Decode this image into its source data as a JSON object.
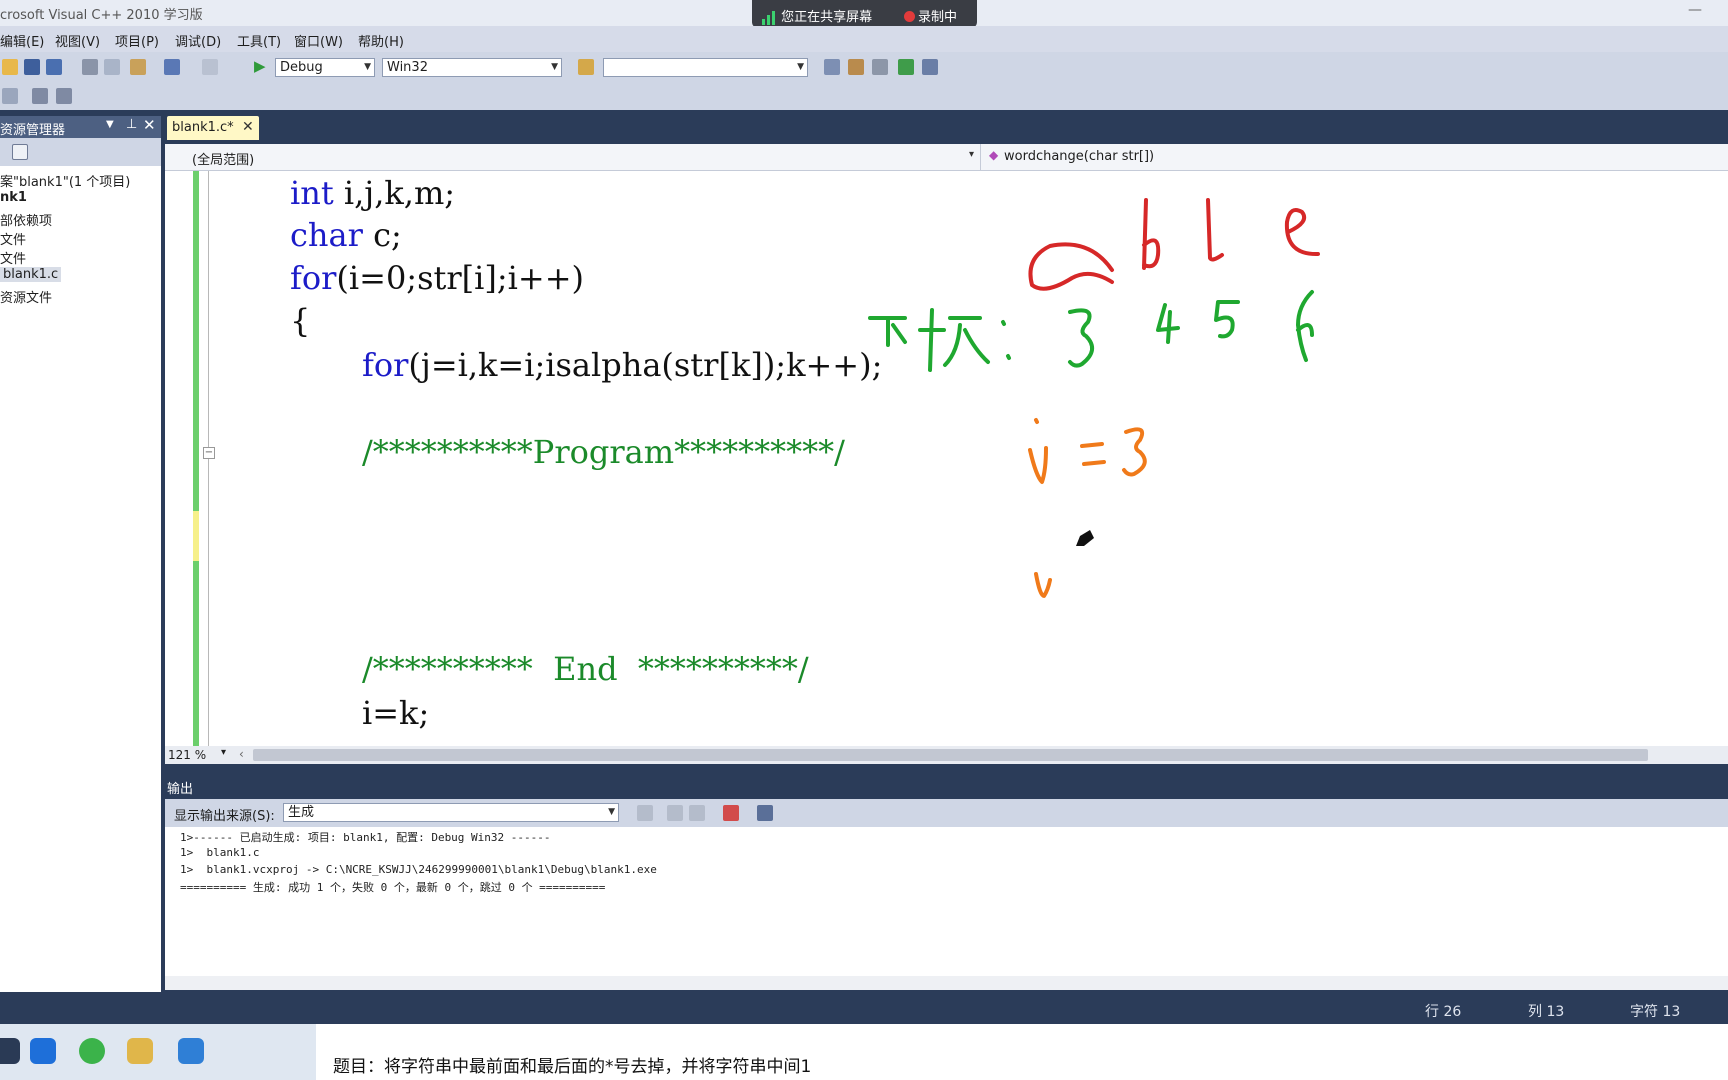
{
  "window": {
    "title": "crosoft Visual C++ 2010 学习版",
    "minimize": "—"
  },
  "share": {
    "sharing_text": "您正在共享屏幕",
    "recording_text": "录制中"
  },
  "menu": [
    "编辑(E)",
    "视图(V)",
    "项目(P)",
    "调试(D)",
    "工具(T)",
    "窗口(W)",
    "帮助(H)"
  ],
  "toolbar": {
    "config": "Debug",
    "platform": "Win32",
    "find": ""
  },
  "solution_explorer": {
    "title": "资源管理器",
    "items": [
      "案\"blank1\"(1 个项目)",
      "nk1",
      "部依赖项",
      "文件",
      "文件",
      "blank1.c",
      "资源文件"
    ]
  },
  "editor": {
    "tab_label": "blank1.c*",
    "scope": "(全局范围)",
    "function": "wordchange(char str[])",
    "zoom": "121 %",
    "lines": [
      {
        "kw": "int",
        "rest": " i,j,k,m;"
      },
      {
        "kw": "char",
        "rest": " c;"
      },
      {
        "kw": "for",
        "rest": "(i=0;str[i];i++)"
      },
      {
        "kw": "",
        "rest": "{"
      },
      {
        "kw": "for",
        "rest": "(j=i,k=i;isalpha(str[k]);k++);"
      },
      {
        "kw": "",
        "rest": ""
      },
      {
        "comment": "/**********Program**********/"
      },
      {
        "kw": "",
        "rest": ""
      },
      {
        "kw": "",
        "rest": ""
      },
      {
        "kw": "",
        "rest": ""
      },
      {
        "kw": "",
        "rest": ""
      },
      {
        "comment": "/**********  End  **********/"
      },
      {
        "kw": "",
        "rest": "i=k;"
      }
    ]
  },
  "annotations": {
    "letters": [
      "a",
      "b",
      "l",
      "e"
    ],
    "label": "下标:",
    "indices": [
      "3",
      "4",
      "5",
      "6"
    ],
    "assignment": "i=3"
  },
  "output": {
    "title": "输出",
    "source_label": "显示输出来源(S):",
    "source_value": "生成",
    "lines": [
      "1>------ 已启动生成: 项目: blank1, 配置: Debug Win32 ------",
      "1>  blank1.c",
      "1>  blank1.vcxproj -> C:\\NCRE_KSWJJ\\246299990001\\blank1\\Debug\\blank1.exe",
      "========== 生成: 成功 1 个，失败 0 个，最新 0 个，跳过 0 个 =========="
    ]
  },
  "status": {
    "line": "行 26",
    "col": "列 13",
    "char": "字符 13"
  },
  "caption": "题目：将字符串中最前面和最后面的*号去掉，并将字符串中间1",
  "colors": {
    "ink_red": "#d62828",
    "ink_green": "#1fa830",
    "ink_orange": "#f07a1a",
    "keyword": "#1c1cc8",
    "comment": "#1b8a2a"
  }
}
